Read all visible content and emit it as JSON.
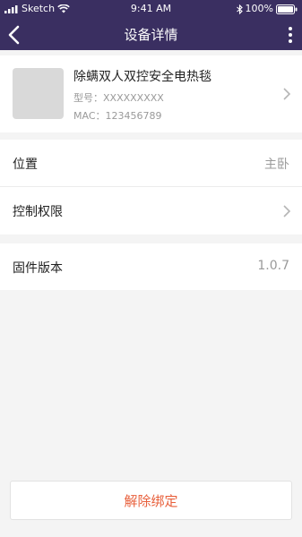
{
  "status_bar": {
    "carrier": "Sketch",
    "time": "9:41 AM",
    "battery": "100%"
  },
  "nav": {
    "title": "设备详情",
    "back_icon": "chevron-left-icon",
    "more_icon": "more-vertical-icon"
  },
  "device": {
    "name": "除螨双人双控安全电热毯",
    "model_label": "型号：",
    "model_value": "XXXXXXXXX",
    "mac_label": "MAC：",
    "mac_value": "123456789"
  },
  "settings": {
    "location_label": "位置",
    "location_value": "主卧",
    "permission_label": "控制权限",
    "firmware_label": "固件版本",
    "firmware_value": "1.0.7"
  },
  "actions": {
    "unbind_label": "解除绑定"
  },
  "colors": {
    "header_bg": "#3a2f61",
    "accent_red": "#e8603c",
    "page_bg": "#f4f4f4"
  }
}
